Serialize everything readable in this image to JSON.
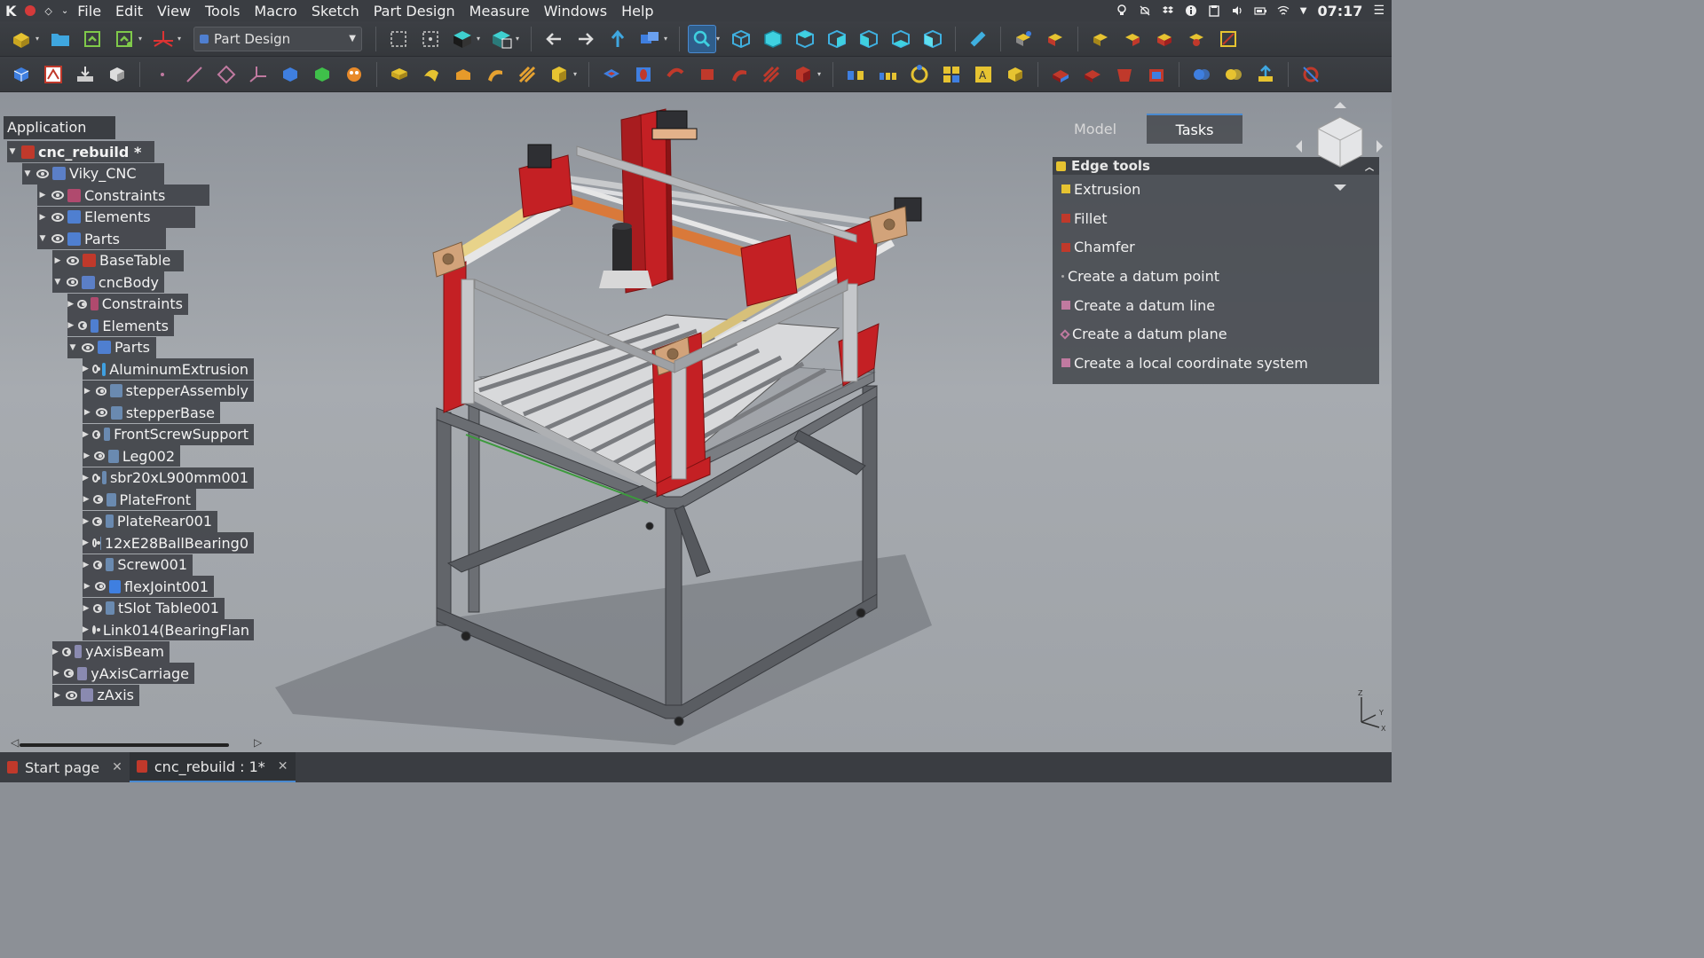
{
  "menubar": {
    "items": [
      "File",
      "Edit",
      "View",
      "Tools",
      "Macro",
      "Sketch",
      "Part Design",
      "Measure",
      "Windows",
      "Help"
    ],
    "clock": "07:17"
  },
  "toolbar": {
    "workbench": "Part Design"
  },
  "tree": {
    "header": "Application",
    "rows": [
      {
        "label": "cnc_rebuild *",
        "icon_color": "#c0392b"
      },
      {
        "label": "Viky_CNC",
        "icon_color": "#5b7fc7"
      },
      {
        "label": "Constraints",
        "icon_color": "#b04a6e"
      },
      {
        "label": "Elements",
        "icon_color": "#4f7fd0"
      },
      {
        "label": "Parts",
        "icon_color": "#4f7fd0"
      },
      {
        "label": "BaseTable",
        "icon_color": "#c0392b"
      },
      {
        "label": "cncBody",
        "icon_color": "#5b7fc7"
      },
      {
        "label": "Constraints",
        "icon_color": "#b04a6e"
      },
      {
        "label": "Elements",
        "icon_color": "#4f7fd0"
      },
      {
        "label": "Parts",
        "icon_color": "#4f7fd0"
      },
      {
        "label": "AluminumExtrusion",
        "icon_color": "#3fa0e0"
      },
      {
        "label": "stepperAssembly",
        "icon_color": "#6a8ab0"
      },
      {
        "label": "stepperBase",
        "icon_color": "#6a8ab0"
      },
      {
        "label": "FrontScrewSupport",
        "icon_color": "#6a8ab0"
      },
      {
        "label": "Leg002",
        "icon_color": "#6a8ab0"
      },
      {
        "label": "sbr20xL900mm001",
        "icon_color": "#6a8ab0"
      },
      {
        "label": "PlateFront",
        "icon_color": "#6a8ab0"
      },
      {
        "label": "PlateRear001",
        "icon_color": "#6a8ab0"
      },
      {
        "label": "12xE28BallBearing0",
        "icon_color": "#6a8ab0"
      },
      {
        "label": "Screw001",
        "icon_color": "#6a8ab0"
      },
      {
        "label": "flexJoint001",
        "icon_color": "#3f7fe0"
      },
      {
        "label": "tSlot Table001",
        "icon_color": "#6a8ab0"
      },
      {
        "label": "Link014(BearingFlan",
        "icon_color": "#6a8ab0"
      },
      {
        "label": "yAxisBeam",
        "icon_color": "#8a8ab0"
      },
      {
        "label": "yAxisCarriage",
        "icon_color": "#8a8ab0"
      },
      {
        "label": "zAxis",
        "icon_color": "#8a8ab0"
      }
    ]
  },
  "tasks": {
    "tab_model": "Model",
    "tab_tasks": "Tasks",
    "title": "Edge tools",
    "items": [
      {
        "label": "Extrusion",
        "icon_color": "#e6c331"
      },
      {
        "label": "Fillet",
        "icon_color": "#c0392b"
      },
      {
        "label": "Chamfer",
        "icon_color": "#c0392b"
      },
      {
        "label": "Create a datum point",
        "icon_color": "#aaaaaa"
      },
      {
        "label": "Create a datum line",
        "icon_color": "#c07aa0"
      },
      {
        "label": "Create a datum plane",
        "icon_color": "#c07aa0"
      },
      {
        "label": "Create a local coordinate system",
        "icon_color": "#c07aa0"
      }
    ]
  },
  "doc_tabs": [
    {
      "label": "Start page"
    },
    {
      "label": "cnc_rebuild : 1*"
    }
  ],
  "axes": {
    "x": "X",
    "y": "Y",
    "z": "Z"
  },
  "colors": {
    "accent": "#4a8ad0",
    "machine_red": "#c42024",
    "frame_gray": "#5e6166"
  }
}
